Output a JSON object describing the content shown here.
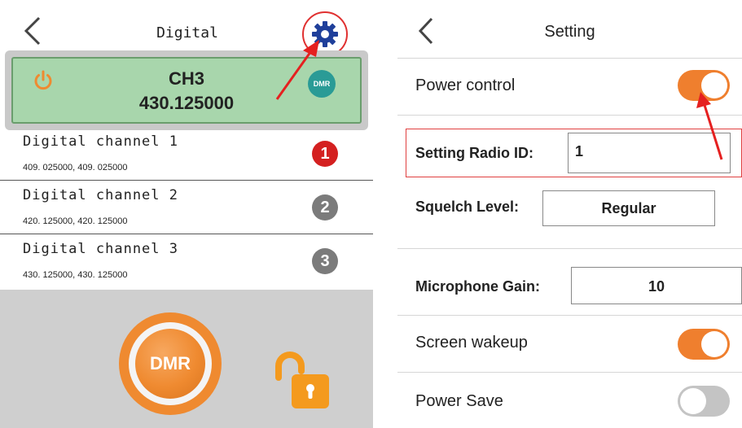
{
  "left_screen": {
    "title": "Digital",
    "current_channel": {
      "name": "CH3",
      "frequency": "430.125000",
      "badge": "DMR"
    },
    "channels": [
      {
        "label": "Digital channel 1",
        "frequencies": "409. 025000, 409. 025000",
        "number": "1",
        "selected": true
      },
      {
        "label": "Digital channel 2",
        "frequencies": "420. 125000, 420. 125000",
        "number": "2",
        "selected": false
      },
      {
        "label": "Digital channel 3",
        "frequencies": "430. 125000, 430. 125000",
        "number": "3",
        "selected": false
      }
    ],
    "ptt_button_label": "DMR",
    "icons": {
      "back": "chevron-left-icon",
      "settings": "gear-icon",
      "power": "power-icon",
      "lock": "unlocked-padlock-icon"
    }
  },
  "right_screen": {
    "title": "Setting",
    "power_control": {
      "label": "Power control",
      "enabled": true
    },
    "radio_id": {
      "label": "Setting Radio ID:",
      "value": "1"
    },
    "squelch_level": {
      "label": "Squelch Level:",
      "value": "Regular"
    },
    "microphone_gain": {
      "label": "Microphone Gain:",
      "value": "10"
    },
    "screen_wakeup": {
      "label": "Screen wakeup",
      "enabled": true
    },
    "power_save": {
      "label": "Power Save",
      "enabled": false
    }
  },
  "colors": {
    "accent_orange": "#ef7f2e",
    "card_green": "#a8d6ac",
    "selected_red": "#d42020",
    "dmr_teal": "#2a9b96",
    "gear_blue": "#1f3f9a",
    "highlight_red": "#e03030"
  }
}
